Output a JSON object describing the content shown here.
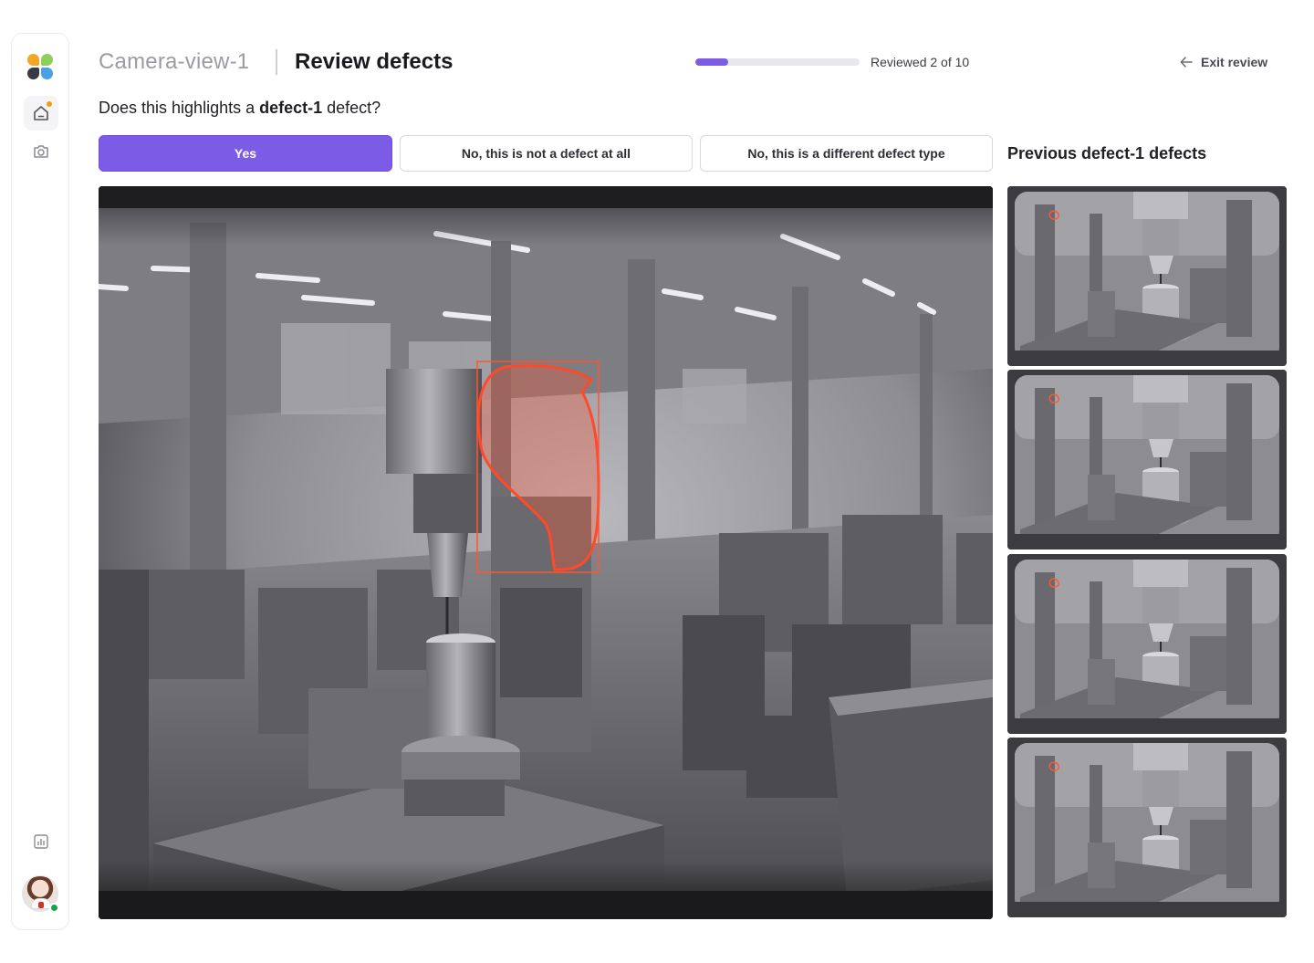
{
  "sidebar": {
    "logo_icon": "app-logo",
    "items": [
      {
        "name": "home",
        "icon": "home-icon",
        "has_notification": true
      },
      {
        "name": "camera",
        "icon": "camera-icon"
      },
      {
        "name": "stats",
        "icon": "bar-chart-icon"
      }
    ],
    "user": {
      "status": "online"
    }
  },
  "header": {
    "parent": "Camera-view-1",
    "title": "Review defects",
    "progress": {
      "reviewed": 2,
      "total": 10,
      "fraction": 0.2,
      "label": "Reviewed 2 of 10"
    },
    "exit_label": "Exit review"
  },
  "question": {
    "prefix": "Does this highlights a ",
    "defect": "defect-1",
    "suffix": " defect?"
  },
  "choices": {
    "yes": "Yes",
    "not_defect": "No, this is not a defect at all",
    "different_type": "No, this is a different defect type"
  },
  "previous": {
    "prefix": "Previous ",
    "defect": "defect-1",
    "suffix": " defects"
  },
  "colors": {
    "accent": "#7c5ce6",
    "highlight": "#ff5533",
    "online": "#16a34a",
    "notification": "#f59e0b"
  }
}
